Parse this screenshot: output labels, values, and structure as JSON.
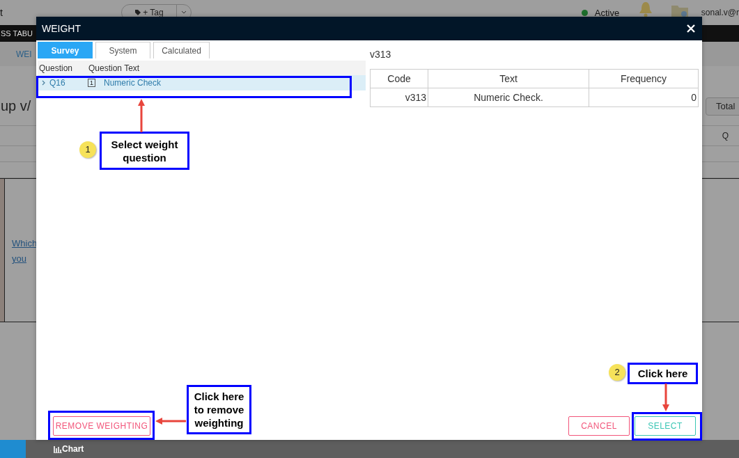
{
  "background": {
    "topbar": {
      "title_fragment": "t",
      "tag_button": "+ Tag",
      "status": "Active",
      "user": "sonal.v@r"
    },
    "nav_tab": "SS TABU",
    "sub_tab": "WEI",
    "heading": "up v/",
    "total_button": "Total",
    "column_header": "Q",
    "question_link": "Which you"
  },
  "bottom_bar": {
    "items": [
      {
        "label": "Chart"
      }
    ]
  },
  "dialog": {
    "title": "WEIGHT",
    "tabs": [
      {
        "label": "Survey",
        "selected": true
      },
      {
        "label": "System",
        "selected": false
      },
      {
        "label": "Calculated",
        "selected": false
      }
    ],
    "question_list": {
      "columns": [
        "Question",
        "Question Text"
      ],
      "rows": [
        {
          "code": "Q16",
          "badge": "1",
          "text": "Numeric Check",
          "selected": true,
          "expanded": false
        }
      ]
    },
    "detail": {
      "title": "v313",
      "table": {
        "columns": [
          "Code",
          "Text",
          "Frequency"
        ],
        "rows": [
          [
            "v313",
            "Numeric Check.",
            "0"
          ]
        ]
      }
    },
    "buttons": [
      {
        "label": "REMOVE WEIGHTING",
        "kind": "danger"
      },
      {
        "label": "CANCEL",
        "kind": "danger"
      },
      {
        "label": "SELECT",
        "kind": "primary"
      }
    ]
  },
  "annotations": [
    {
      "badge": "1",
      "text": "Select weight question"
    },
    {
      "badge": "2",
      "text": "Click here"
    },
    {
      "text": "Click here to remove weighting"
    }
  ]
}
